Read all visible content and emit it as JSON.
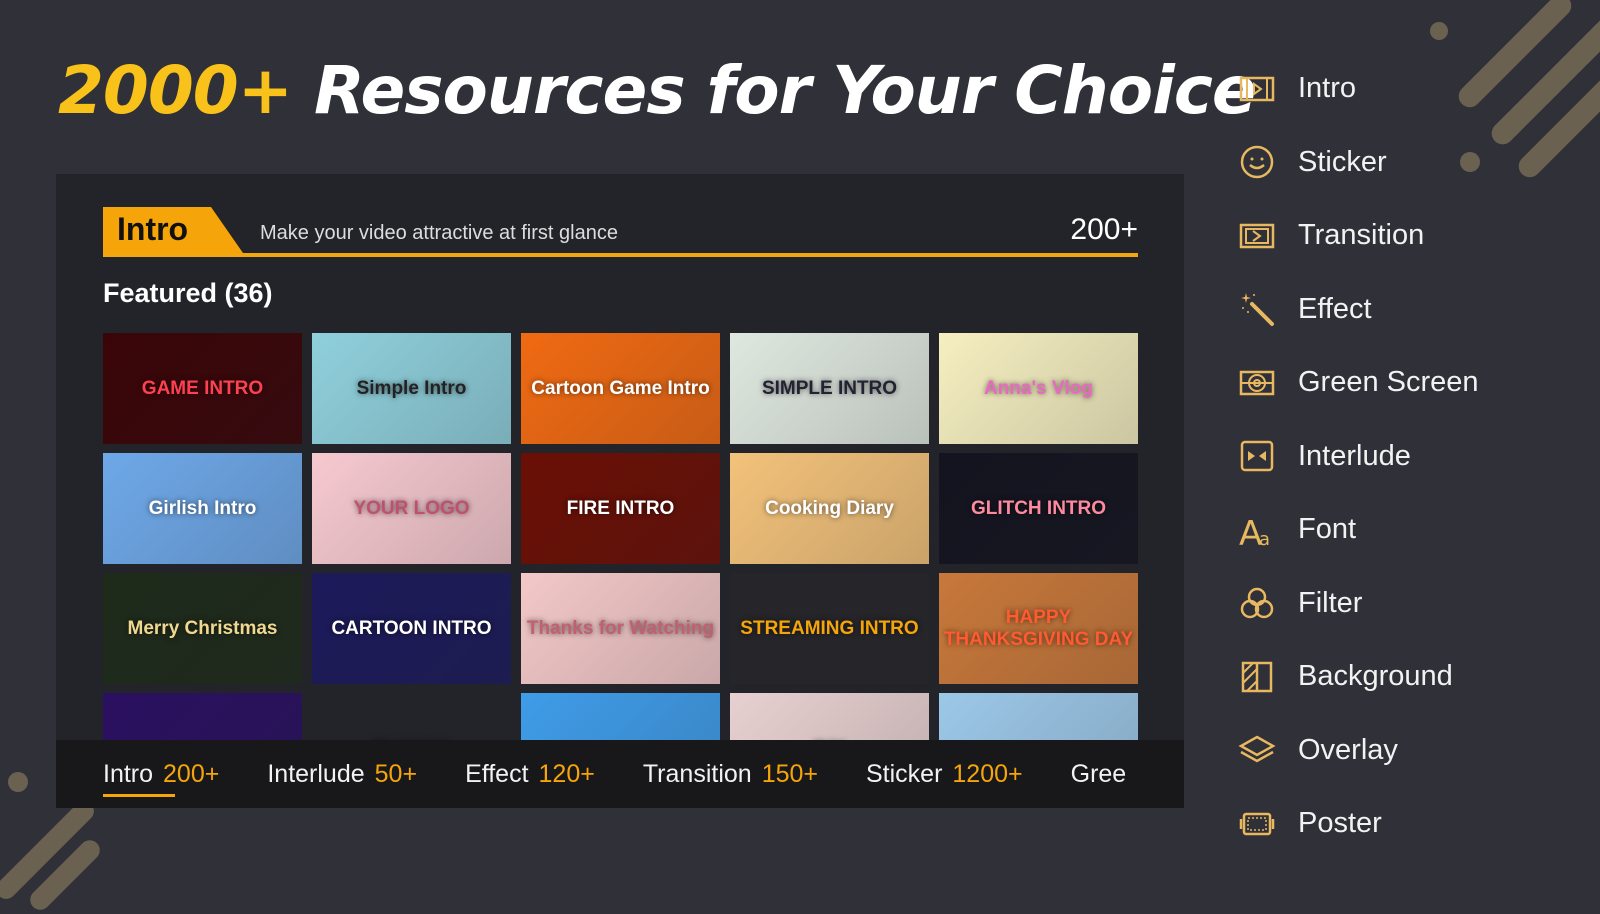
{
  "headline": {
    "highlight": "2000+",
    "rest": " Resources for Your Choice"
  },
  "panel": {
    "tag": "Intro",
    "subtitle": "Make your video attractive at first glance",
    "count": "200+",
    "featured": "Featured (36)",
    "thumbnails": [
      {
        "label": "GAME INTRO",
        "bg": "#3a0508",
        "fg": "#ff4050"
      },
      {
        "label": "Simple Intro",
        "bg": "#8fd0dc",
        "fg": "#222"
      },
      {
        "label": "Cartoon Game Intro",
        "bg": "#f06a12",
        "fg": "#fff"
      },
      {
        "label": "SIMPLE INTRO",
        "bg": "#dfe8df",
        "fg": "#223"
      },
      {
        "label": "Anna's Vlog",
        "bg": "#f5efc0",
        "fg": "#e86ac0"
      },
      {
        "label": "Girlish Intro",
        "bg": "#6ea8e8",
        "fg": "#fff"
      },
      {
        "label": "YOUR LOGO",
        "bg": "#f6c9cf",
        "fg": "#c05070"
      },
      {
        "label": "FIRE INTRO",
        "bg": "#6a0f05",
        "fg": "#fff"
      },
      {
        "label": "Cooking Diary",
        "bg": "#f3c27a",
        "fg": "#fff"
      },
      {
        "label": "GLITCH INTRO",
        "bg": "#141420",
        "fg": "#ff8aa0"
      },
      {
        "label": "Merry Christmas",
        "bg": "#1e2a1a",
        "fg": "#f0d890"
      },
      {
        "label": "CARTOON INTRO",
        "bg": "#1c1a5a",
        "fg": "#fff"
      },
      {
        "label": "Thanks for Watching",
        "bg": "#f3c8c8",
        "fg": "#c06070"
      },
      {
        "label": "STREAMING INTRO",
        "bg": "#26262a",
        "fg": "#f5a50a"
      },
      {
        "label": "HAPPY THANKSGIVING DAY",
        "bg": "#c8783a",
        "fg": "#ff5a30"
      },
      {
        "label": "",
        "bg": "#2a1060",
        "fg": "#fff"
      },
      {
        "label": "THANKS",
        "bg": "#111",
        "fg": "#c8a850"
      },
      {
        "label": "",
        "bg": "#3f9ce8",
        "fg": "#fff"
      },
      {
        "label": "INK",
        "bg": "#e8d0d0",
        "fg": "#2a40a0"
      },
      {
        "label": "",
        "bg": "#9cc8e8",
        "fg": "#fff"
      }
    ]
  },
  "bottom_tabs": [
    {
      "label": "Intro",
      "count": "200+",
      "active": true
    },
    {
      "label": "Interlude",
      "count": "50+"
    },
    {
      "label": "Effect",
      "count": "120+"
    },
    {
      "label": "Transition",
      "count": "150+"
    },
    {
      "label": "Sticker",
      "count": "1200+"
    },
    {
      "label": "Gree",
      "count": ""
    }
  ],
  "sidebar": [
    {
      "label": "Intro",
      "icon": "film-play-icon"
    },
    {
      "label": "Sticker",
      "icon": "smiley-icon"
    },
    {
      "label": "Transition",
      "icon": "transition-icon"
    },
    {
      "label": "Effect",
      "icon": "magic-wand-icon"
    },
    {
      "label": "Green Screen",
      "icon": "target-screen-icon"
    },
    {
      "label": "Interlude",
      "icon": "interlude-icon"
    },
    {
      "label": "Font",
      "icon": "font-icon"
    },
    {
      "label": "Filter",
      "icon": "filter-circles-icon"
    },
    {
      "label": "Background",
      "icon": "background-icon"
    },
    {
      "label": "Overlay",
      "icon": "layers-icon"
    },
    {
      "label": "Poster",
      "icon": "poster-icon"
    }
  ],
  "colors": {
    "accent": "#f5a50a",
    "icon": "#e8b860",
    "background": "#2f3038",
    "panel": "#232429"
  }
}
